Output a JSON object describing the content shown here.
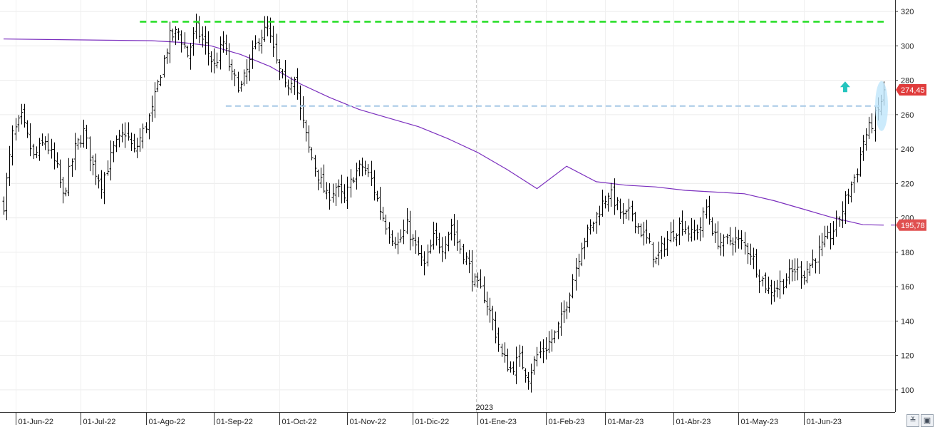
{
  "chart_data": {
    "type": "ohlc",
    "title": "",
    "xlabel": "",
    "ylabel": "",
    "ylim": [
      90,
      325
    ],
    "y_ticks": [
      100,
      120,
      140,
      160,
      180,
      200,
      220,
      240,
      260,
      280,
      300,
      320
    ],
    "grid": true,
    "x_tick_labels": [
      "01-Jun-22",
      "01-Jul-22",
      "01-Ago-22",
      "01-Sep-22",
      "01-Oct-22",
      "01-Nov-22",
      "01-Dic-22",
      "01-Ene-23",
      "01-Feb-23",
      "01-Mar-23",
      "01-Abr-23",
      "01-May-23",
      "01-Jun-23"
    ],
    "year_label": "2023",
    "price_label": "274,45",
    "ma_label": "195,78",
    "price_value": 274.45,
    "ma_value": 195.78,
    "resistance_level": 314,
    "support_level": 265,
    "anchors": [
      [
        0,
        208
      ],
      [
        3,
        248
      ],
      [
        6,
        258
      ],
      [
        10,
        235
      ],
      [
        14,
        245
      ],
      [
        18,
        228
      ],
      [
        20,
        212
      ],
      [
        24,
        240
      ],
      [
        27,
        250
      ],
      [
        30,
        230
      ],
      [
        33,
        220
      ],
      [
        37,
        240
      ],
      [
        41,
        250
      ],
      [
        44,
        238
      ],
      [
        47,
        250
      ],
      [
        50,
        262
      ],
      [
        53,
        285
      ],
      [
        56,
        305
      ],
      [
        59,
        308
      ],
      [
        62,
        295
      ],
      [
        65,
        310
      ],
      [
        68,
        300
      ],
      [
        71,
        288
      ],
      [
        74,
        302
      ],
      [
        77,
        282
      ],
      [
        80,
        276
      ],
      [
        83,
        290
      ],
      [
        86,
        305
      ],
      [
        89,
        310
      ],
      [
        92,
        290
      ],
      [
        95,
        275
      ],
      [
        98,
        284
      ],
      [
        100,
        262
      ],
      [
        103,
        240
      ],
      [
        106,
        225
      ],
      [
        109,
        212
      ],
      [
        112,
        218
      ],
      [
        115,
        210
      ],
      [
        118,
        225
      ],
      [
        121,
        230
      ],
      [
        124,
        222
      ],
      [
        127,
        205
      ],
      [
        130,
        192
      ],
      [
        133,
        185
      ],
      [
        136,
        195
      ],
      [
        139,
        182
      ],
      [
        142,
        172
      ],
      [
        145,
        188
      ],
      [
        148,
        184
      ],
      [
        151,
        196
      ],
      [
        153,
        186
      ],
      [
        156,
        176
      ],
      [
        159,
        162
      ],
      [
        162,
        155
      ],
      [
        165,
        140
      ],
      [
        168,
        120
      ],
      [
        171,
        112
      ],
      [
        174,
        118
      ],
      [
        177,
        108
      ],
      [
        180,
        120
      ],
      [
        183,
        125
      ],
      [
        186,
        132
      ],
      [
        189,
        145
      ],
      [
        192,
        165
      ],
      [
        195,
        185
      ],
      [
        198,
        194
      ],
      [
        201,
        205
      ],
      [
        204,
        215
      ],
      [
        206,
        210
      ],
      [
        209,
        200
      ],
      [
        212,
        203
      ],
      [
        214,
        195
      ],
      [
        217,
        187
      ],
      [
        220,
        175
      ],
      [
        223,
        185
      ],
      [
        226,
        192
      ],
      [
        229,
        197
      ],
      [
        232,
        190
      ],
      [
        235,
        195
      ],
      [
        237,
        206
      ],
      [
        240,
        188
      ],
      [
        243,
        185
      ],
      [
        246,
        188
      ],
      [
        249,
        185
      ],
      [
        252,
        180
      ],
      [
        255,
        167
      ],
      [
        258,
        158
      ],
      [
        261,
        160
      ],
      [
        264,
        165
      ],
      [
        267,
        170
      ],
      [
        270,
        168
      ],
      [
        273,
        175
      ],
      [
        276,
        183
      ],
      [
        279,
        190
      ],
      [
        282,
        200
      ],
      [
        285,
        215
      ],
      [
        288,
        228
      ],
      [
        290,
        245
      ],
      [
        293,
        255
      ],
      [
        295,
        262
      ],
      [
        297,
        274.45
      ]
    ],
    "moving_average": [
      [
        0,
        304
      ],
      [
        50,
        303
      ],
      [
        60,
        302
      ],
      [
        70,
        300
      ],
      [
        80,
        295
      ],
      [
        90,
        288
      ],
      [
        100,
        278
      ],
      [
        110,
        270
      ],
      [
        120,
        263
      ],
      [
        130,
        258
      ],
      [
        140,
        253
      ],
      [
        150,
        246
      ],
      [
        160,
        238
      ],
      [
        170,
        228
      ],
      [
        180,
        217
      ],
      [
        190,
        230
      ],
      [
        200,
        221
      ],
      [
        210,
        219
      ],
      [
        220,
        218
      ],
      [
        230,
        216
      ],
      [
        240,
        215
      ],
      [
        250,
        214
      ],
      [
        260,
        210
      ],
      [
        270,
        205
      ],
      [
        280,
        200
      ],
      [
        290,
        196
      ],
      [
        297,
        195.78
      ]
    ]
  }
}
